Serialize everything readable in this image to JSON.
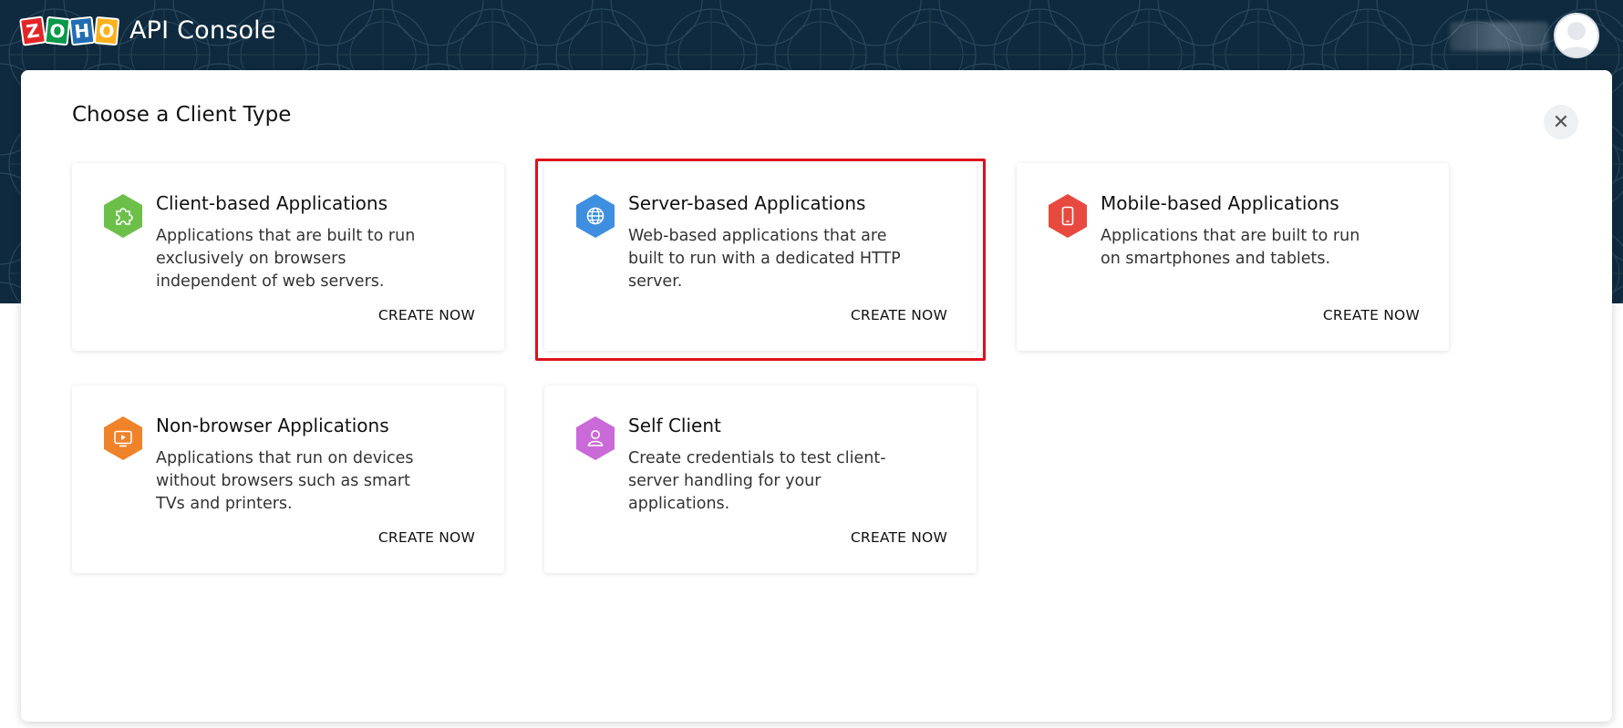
{
  "header": {
    "logo_letters": [
      "Z",
      "O",
      "H",
      "O"
    ],
    "app_title": "API Console"
  },
  "modal": {
    "title": "Choose a Client Type",
    "close_icon": "close-icon"
  },
  "cards": [
    {
      "title": "Client-based Applications",
      "description": "Applications that are built to run exclusively on browsers independent of web servers.",
      "action": "CREATE NOW",
      "icon": "puzzle-icon",
      "color": "#6cc04a"
    },
    {
      "title": "Server-based Applications",
      "description": "Web-based applications that are built to run with a dedicated HTTP server.",
      "action": "CREATE NOW",
      "icon": "globe-icon",
      "color": "#3f8fe0"
    },
    {
      "title": "Mobile-based Applications",
      "description": "Applications that are built to run on smartphones and tablets.",
      "action": "CREATE NOW",
      "icon": "mobile-icon",
      "color": "#e8493f"
    },
    {
      "title": "Non-browser Applications",
      "description": "Applications that run on devices without browsers such as smart TVs and printers.",
      "action": "CREATE NOW",
      "icon": "tv-icon",
      "color": "#f0822a"
    },
    {
      "title": "Self Client",
      "description": "Create credentials to test client-server handling for your applications.",
      "action": "CREATE NOW",
      "icon": "user-icon",
      "color": "#c96ad8"
    }
  ],
  "colors": {
    "header_bg": "#0f2a3e",
    "highlight": "#e0111a"
  }
}
